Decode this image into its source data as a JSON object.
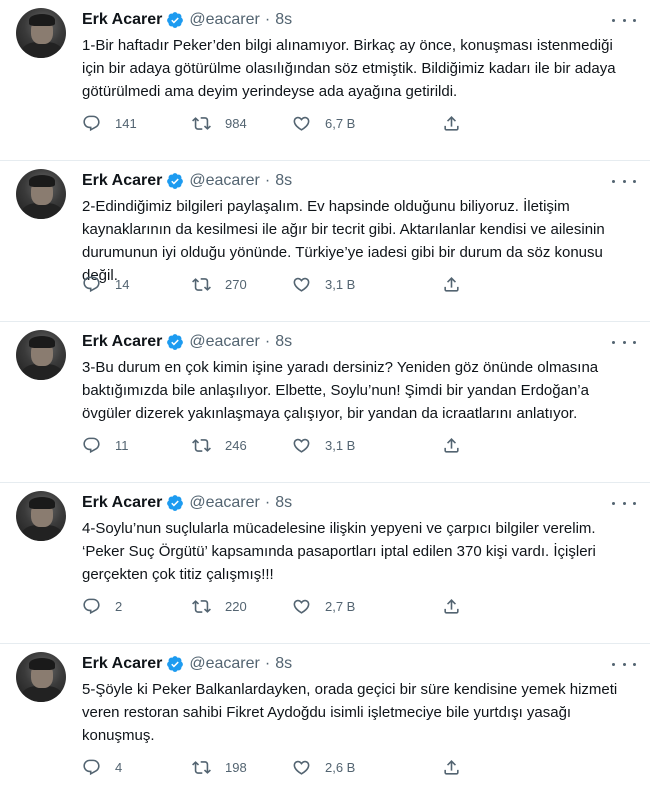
{
  "tweets": [
    {
      "name": "Erk Acarer",
      "handle": "@eacarer",
      "dot": "·",
      "time": "8s",
      "text": "1-Bir haftadır Peker’den bilgi alınamıyor. Birkaç ay önce, konuşması istenmediği için bir adaya götürülme olasılığından söz etmiştik. Bildiğimiz kadarı ile bir adaya götürülmedi ama deyim yerindeyse ada ayağına getirildi.",
      "replies": "141",
      "retweets": "984",
      "likes": "6,7 B"
    },
    {
      "name": "Erk Acarer",
      "handle": "@eacarer",
      "dot": "·",
      "time": "8s",
      "text": "2-Edindiğimiz bilgileri paylaşalım. Ev hapsinde olduğunu biliyoruz. İletişim kaynaklarının da kesilmesi ile ağır bir tecrit gibi. Aktarılanlar kendisi ve ailesinin durumunun iyi olduğu yönünde. Türkiye’ye iadesi gibi bir durum da söz konusu değil.",
      "replies": "14",
      "retweets": "270",
      "likes": "3,1 B"
    },
    {
      "name": "Erk Acarer",
      "handle": "@eacarer",
      "dot": "·",
      "time": "8s",
      "text": "3-Bu durum en çok kimin işine yaradı dersiniz? Yeniden göz önünde olmasına baktığımızda bile anlaşılıyor. Elbette, Soylu’nun! Şimdi bir yandan Erdoğan’a övgüler dizerek yakınlaşmaya çalışıyor, bir yandan da icraatlarını anlatıyor.",
      "replies": "11",
      "retweets": "246",
      "likes": "3,1 B"
    },
    {
      "name": "Erk Acarer",
      "handle": "@eacarer",
      "dot": "·",
      "time": "8s",
      "text": "4-Soylu’nun suçlularla mücadelesine ilişkin yepyeni ve çarpıcı bilgiler verelim. ‘Peker Suç Örgütü’ kapsamında pasaportları iptal edilen 370 kişi vardı. İçişleri gerçekten çok titiz çalışmış!!!",
      "replies": "2",
      "retweets": "220",
      "likes": "2,7 B"
    },
    {
      "name": "Erk Acarer",
      "handle": "@eacarer",
      "dot": "·",
      "time": "8s",
      "text": "5-Şöyle ki Peker Balkanlardayken, orada geçici bir süre kendisine yemek hizmeti veren restoran sahibi Fikret Aydoğdu isimli işletmeciye bile yurtdışı yasağı konuşmuş.",
      "replies": "4",
      "retweets": "198",
      "likes": "2,6 B"
    }
  ],
  "colors": {
    "verified": "#1d9bf0",
    "secondary_text": "#536471",
    "divider": "#e6ecf0"
  },
  "icons": [
    "verified-badge-icon",
    "more-icon",
    "reply-icon",
    "retweet-icon",
    "like-icon",
    "share-icon"
  ]
}
